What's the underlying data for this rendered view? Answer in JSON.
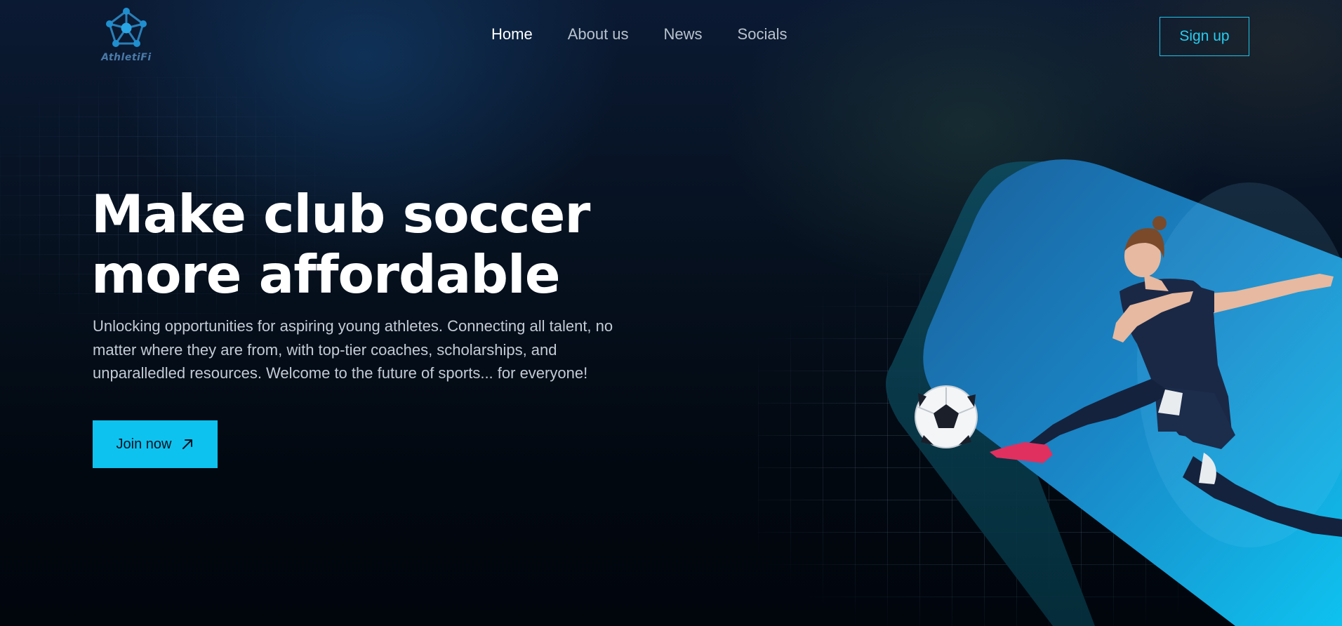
{
  "brand": {
    "name": "AthletiFi",
    "accent_color": "#0ec2ef",
    "logo_icon": "soccer-network-icon"
  },
  "nav": {
    "items": [
      {
        "label": "Home",
        "active": true
      },
      {
        "label": "About us",
        "active": false
      },
      {
        "label": "News",
        "active": false
      },
      {
        "label": "Socials",
        "active": false
      }
    ],
    "signup_label": "Sign up"
  },
  "hero": {
    "title_line1": "Make club soccer",
    "title_line2": "more affordable",
    "subtitle": "Unlocking opportunities for aspiring young athletes. Connecting all talent, no matter where they are from, with top-tier coaches, scholarships, and unparalledled resources. Welcome to the future of sports... for everyone!",
    "cta_label": "Join now",
    "cta_icon": "arrow-up-right-icon",
    "image": "soccer-player-kicking-ball"
  }
}
